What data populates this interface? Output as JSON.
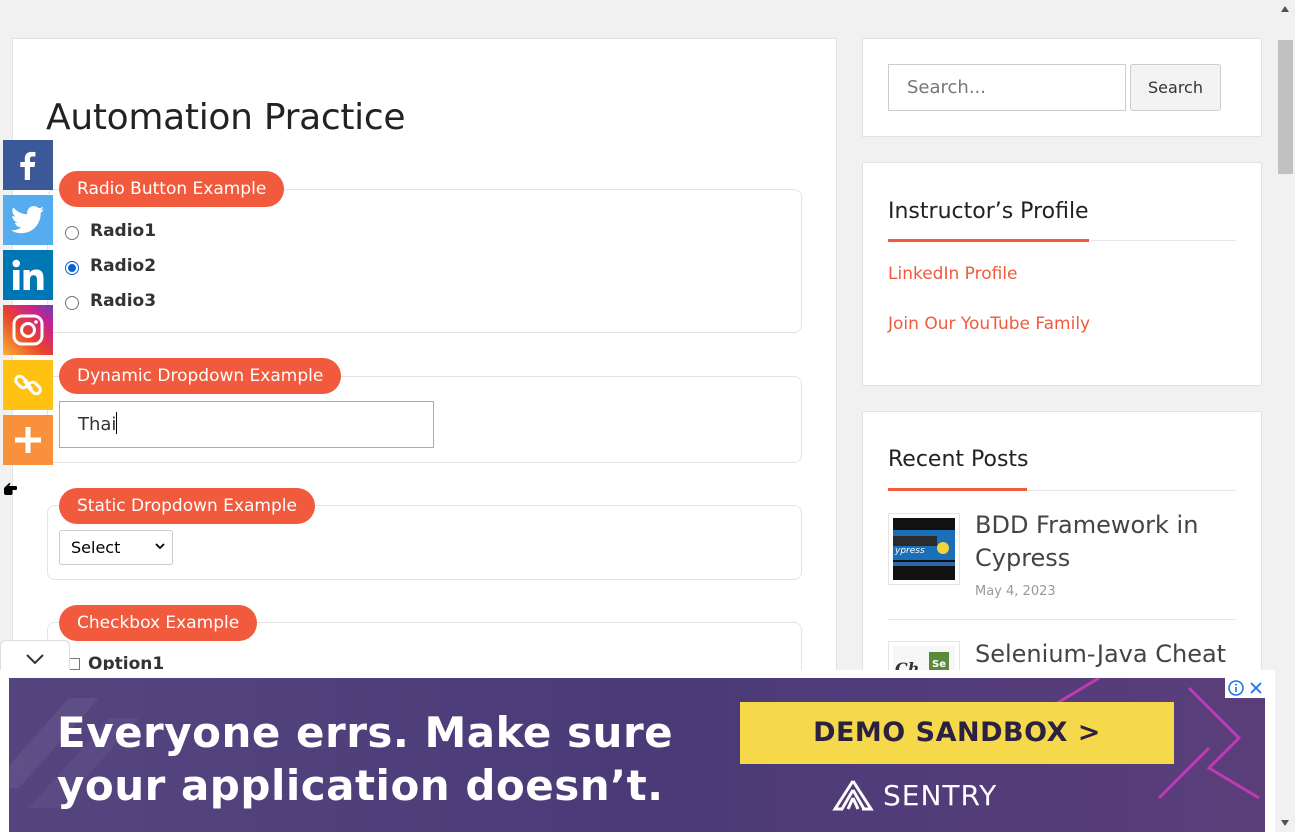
{
  "page": {
    "title": "Automation Practice"
  },
  "radio_section": {
    "legend": "Radio Button Example",
    "options": [
      "Radio1",
      "Radio2",
      "Radio3"
    ],
    "selected": "Radio2"
  },
  "dynamic_dropdown": {
    "legend": "Dynamic Dropdown Example",
    "value": "Thai"
  },
  "static_dropdown": {
    "legend": "Static Dropdown Example",
    "selected": "Select"
  },
  "checkbox_section": {
    "legend": "Checkbox Example",
    "options": [
      "Option1"
    ]
  },
  "share_bar": {
    "buttons": [
      "facebook-icon",
      "twitter-icon",
      "linkedin-icon",
      "instagram-icon",
      "copy-link-icon",
      "more-icon"
    ]
  },
  "sidebar": {
    "search": {
      "placeholder": "Search...",
      "button_label": "Search"
    },
    "profile": {
      "title": "Instructor’s Profile",
      "links": [
        "LinkedIn Profile",
        "Join Our YouTube Family"
      ]
    },
    "recent_posts": {
      "title": "Recent Posts",
      "posts": [
        {
          "title": "BDD Framework in Cypress",
          "date": "May 4, 2023"
        },
        {
          "title": "Selenium-Java Cheat",
          "date": ""
        }
      ]
    }
  },
  "ad": {
    "headline_line1": "Everyone errs. Make sure",
    "headline_line2": "your application doesn’t.",
    "cta": "DEMO SANDBOX >",
    "brand": "SENTRY"
  },
  "colors": {
    "accent": "#f15a3d",
    "facebook": "#3b5998",
    "twitter": "#55acee",
    "linkedin": "#0077b5",
    "copy": "#ffc112",
    "more": "#f8903c",
    "ad_bg": "#4b3a78",
    "ad_cta": "#f6d94a"
  }
}
